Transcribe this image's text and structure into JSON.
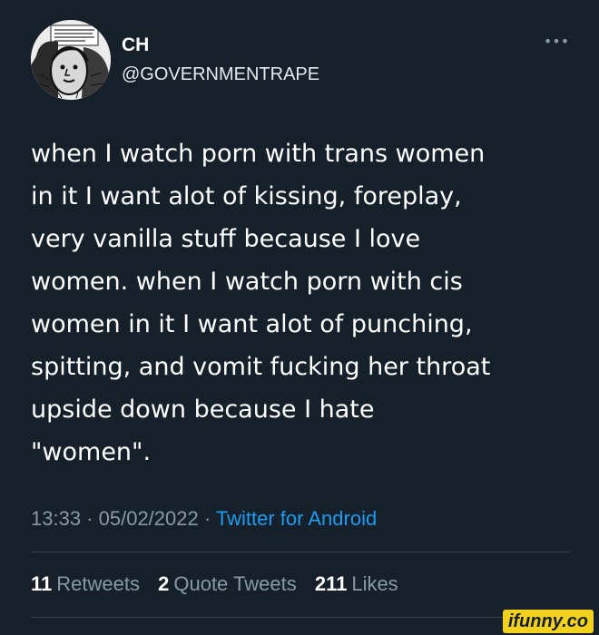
{
  "author": {
    "display_name": "CH",
    "handle": "@GOVERNMENTRAPE",
    "avatar_comic_text": "...GIANT THINGS ARE WAKING...AND IT DOESN'T THINK WE'RE..."
  },
  "more_icon": "•••",
  "tweet": {
    "lines": [
      "when I watch porn with trans women",
      "in it I want alot of kissing, foreplay,",
      "very vanilla stuff because I love",
      "women. when I watch porn with cis",
      "women in it I want alot of punching,",
      "spitting, and vomit fucking her throat",
      "upside down because I hate",
      "\"women\"."
    ]
  },
  "meta": {
    "time": "13:33",
    "separator": " · ",
    "date": "05/02/2022",
    "source": "Twitter for Android"
  },
  "stats": {
    "retweets_count": "11",
    "retweets_label": "Retweets",
    "quote_tweets_count": "2",
    "quote_tweets_label": "Quote Tweets",
    "likes_count": "211",
    "likes_label": "Likes"
  },
  "watermark": "ifunny.co",
  "colors": {
    "background": "#15202b",
    "primary_text": "#ffffff",
    "secondary_text": "#8899a6",
    "link": "#1d9bf0",
    "divider": "#38444d",
    "watermark_bg": "#f3d21f"
  }
}
